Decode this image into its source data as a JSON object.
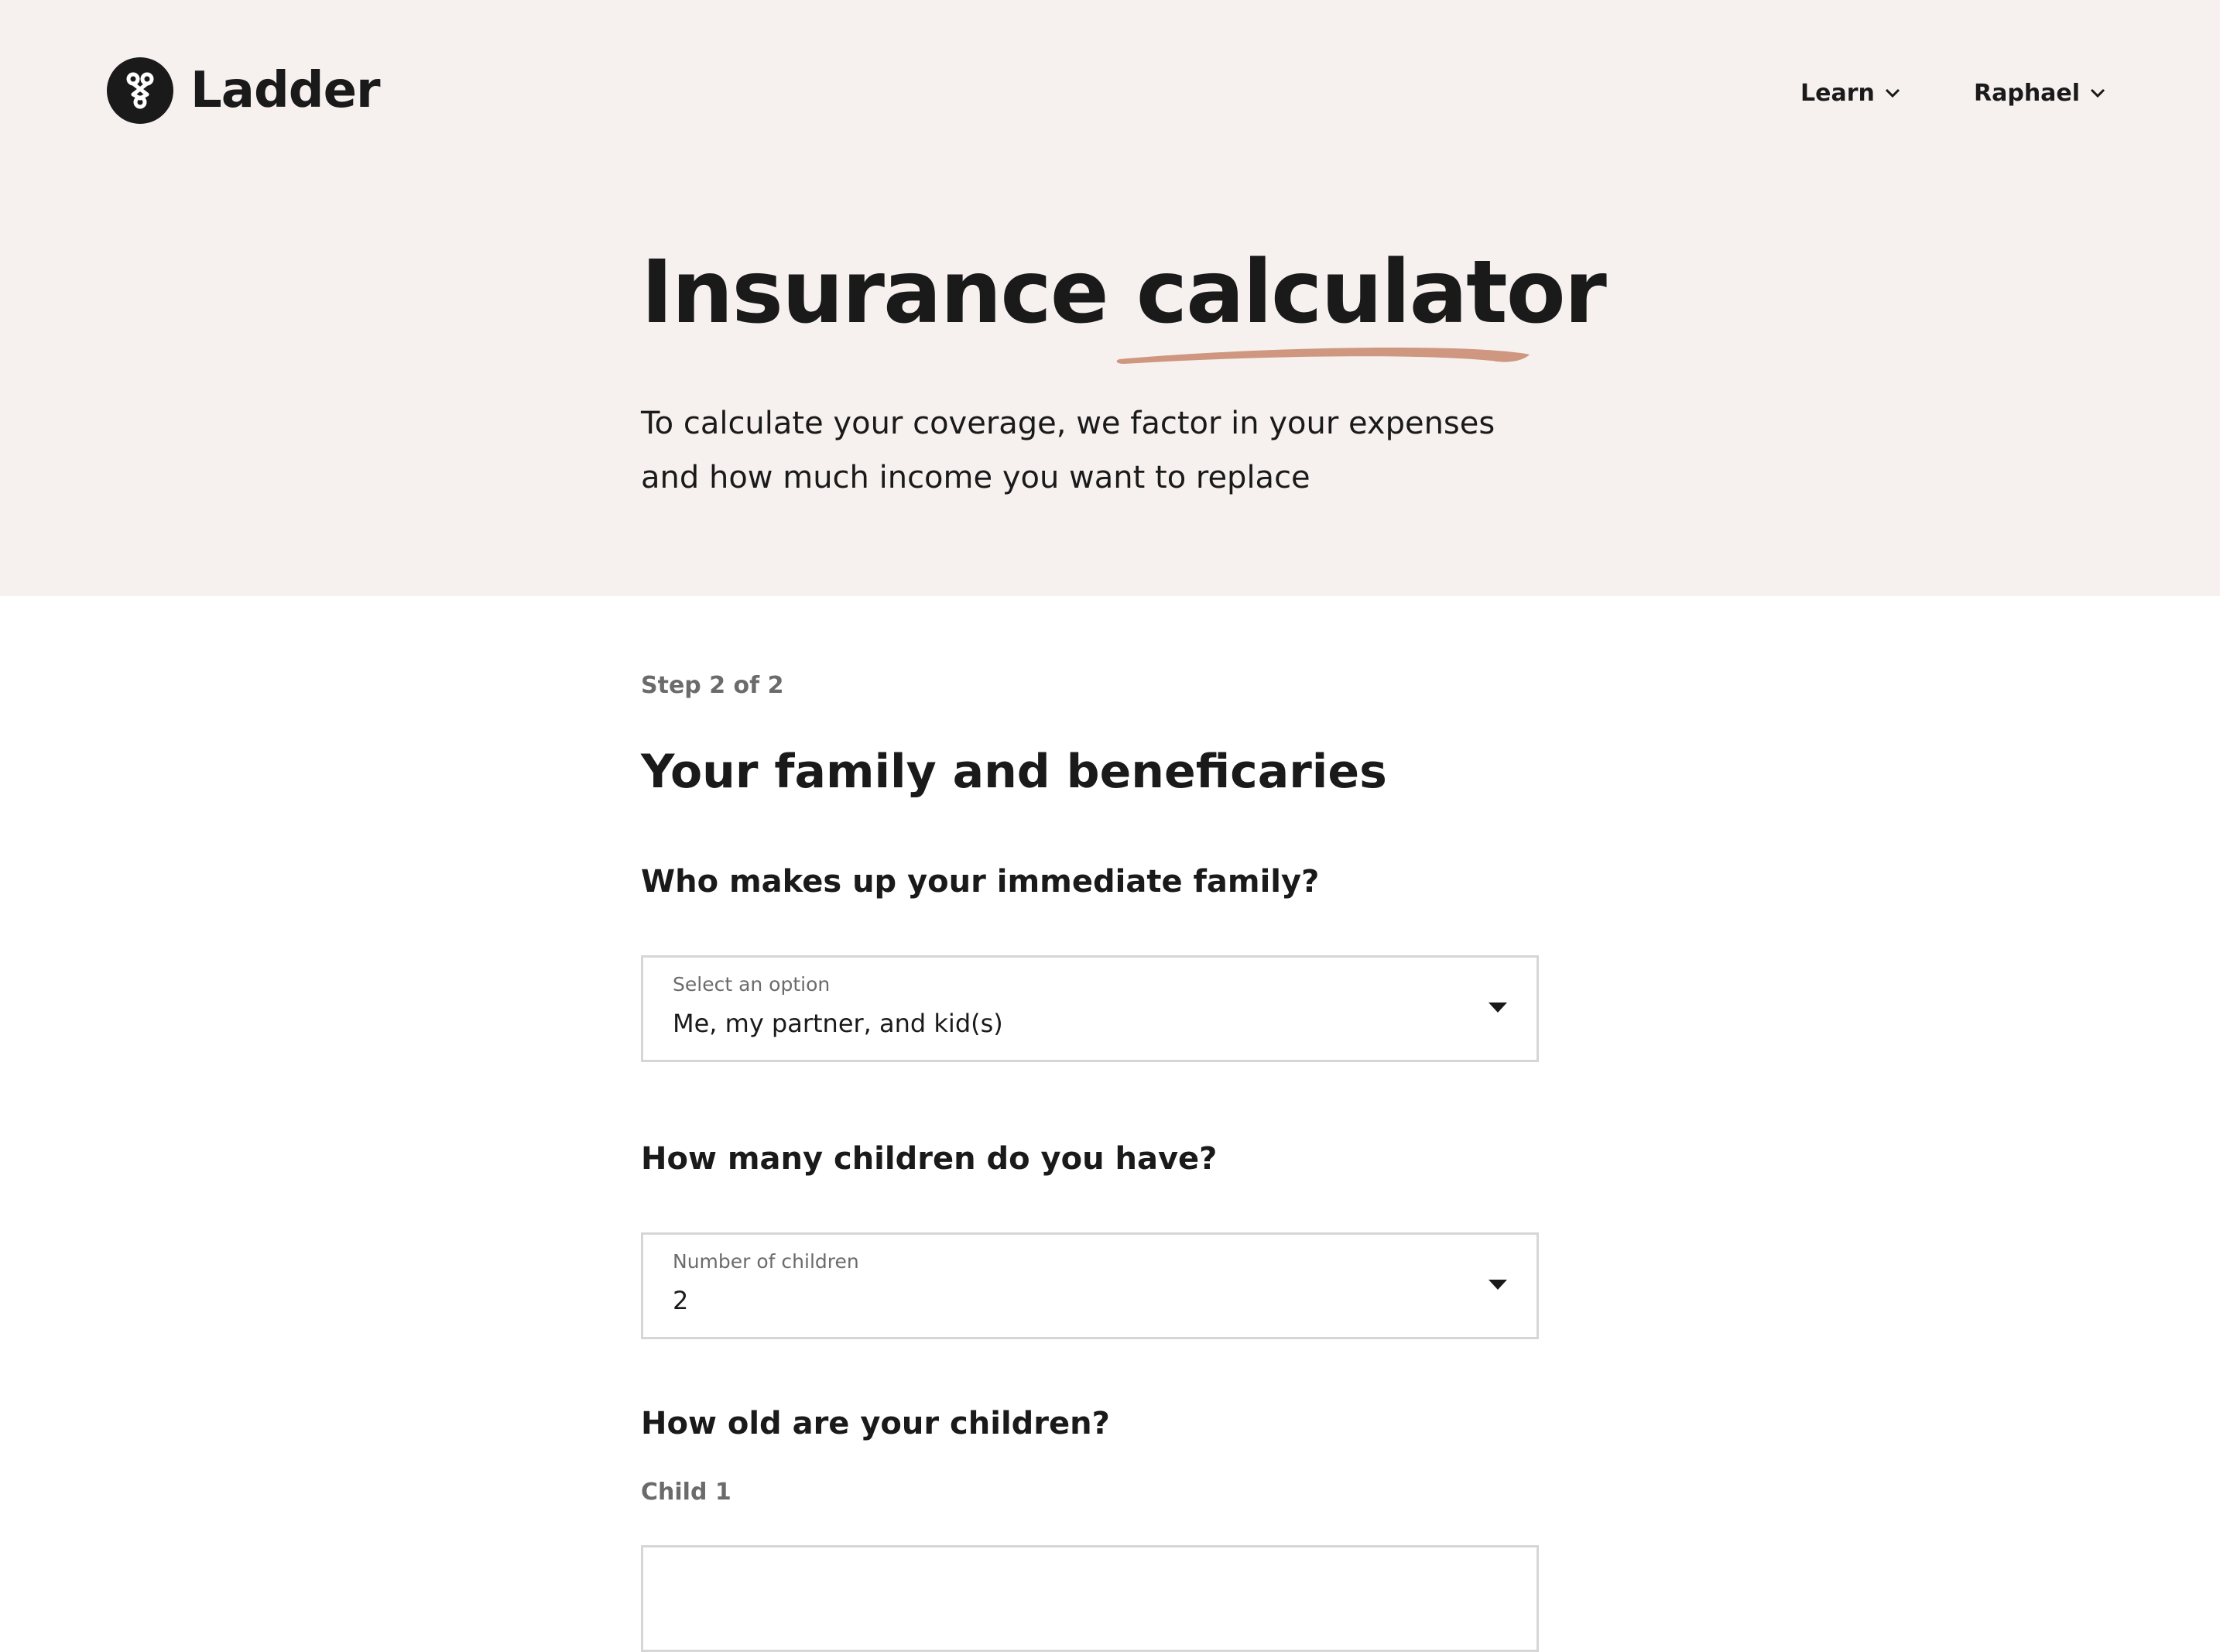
{
  "brand": {
    "name": "Ladder",
    "logo_icon": "ladder-knot-icon"
  },
  "nav": {
    "learn_label": "Learn",
    "user_label": "Raphael"
  },
  "hero": {
    "title": "Insurance calculator",
    "subtitle": "To calculate your coverage, we factor in your expenses and how much income you want to replace",
    "underline_color": "#cf9680",
    "background": "#f6f1ef"
  },
  "form": {
    "step": "Step 2 of 2",
    "section_title": "Your family and beneficaries",
    "family_question": "Who makes up your immediate family?",
    "family_select": {
      "label": "Select an option",
      "value": "Me, my partner, and kid(s)"
    },
    "children_question": "How many children do you have?",
    "children_select": {
      "label": "Number of children",
      "value": "2"
    },
    "ages_question": "How old are your children?",
    "child1_label": "Child 1"
  }
}
